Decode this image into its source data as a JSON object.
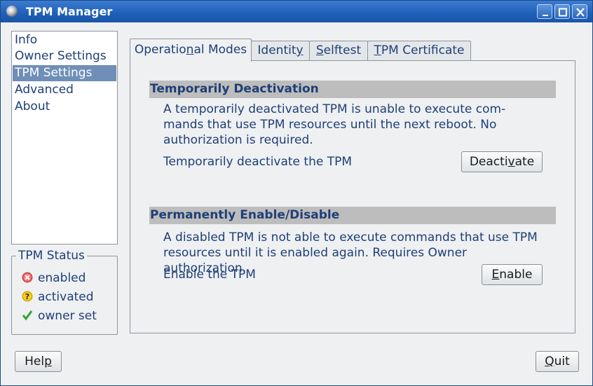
{
  "window": {
    "title": "TPM Manager"
  },
  "titlebar_buttons": {
    "minimize": "minimize-icon",
    "maximize": "maximize-icon",
    "close": "close-icon"
  },
  "sidebar": {
    "items": [
      {
        "label": "Info",
        "selected": false
      },
      {
        "label": "Owner Settings",
        "selected": false
      },
      {
        "label": "TPM Settings",
        "selected": true
      },
      {
        "label": "Advanced",
        "selected": false
      },
      {
        "label": "About",
        "selected": false
      }
    ]
  },
  "tpm_status": {
    "title": "TPM Status",
    "items": [
      {
        "label": "enabled",
        "icon": "error-icon",
        "color": "#d33b3b"
      },
      {
        "label": "activated",
        "icon": "question-icon",
        "color": "#e2b400"
      },
      {
        "label": "owner set",
        "icon": "checkmark-icon",
        "color": "#2fa52f"
      }
    ]
  },
  "tabs": [
    {
      "pre": "Operatio",
      "u": "n",
      "post": "al Modes",
      "active": true
    },
    {
      "pre": "Identit",
      "u": "y",
      "post": "",
      "active": false
    },
    {
      "pre": "",
      "u": "S",
      "post": "elftest",
      "active": false
    },
    {
      "pre": "",
      "u": "T",
      "post": "PM Certificate",
      "active": false
    }
  ],
  "sections": {
    "deactivation": {
      "header": "Temporarily Deactivation",
      "description": "A temporarily deactivated TPM is unable to execute com- mands that use TPM resources until the next reboot. No authorization is required.",
      "action_label": "Temporarily deactivate the TPM",
      "button": {
        "pre": "Deacti",
        "u": "v",
        "post": "ate"
      }
    },
    "enable": {
      "header": "Permanently Enable/Disable",
      "description": "A disabled TPM is not able to execute commands that use TPM resources until it is enabled again. Requires Owner authorization.",
      "action_label": "Enable the TPM",
      "button": {
        "pre": "",
        "u": "E",
        "post": "nable"
      }
    }
  },
  "footer": {
    "help": {
      "pre": "Hel",
      "u": "p",
      "post": ""
    },
    "quit": {
      "pre": "",
      "u": "Q",
      "post": "uit"
    }
  },
  "colors": {
    "accent": "#6f8eb8",
    "text": "#1f3f77",
    "titlebar": "#2a66be",
    "section_header": "#bdbdbd"
  }
}
